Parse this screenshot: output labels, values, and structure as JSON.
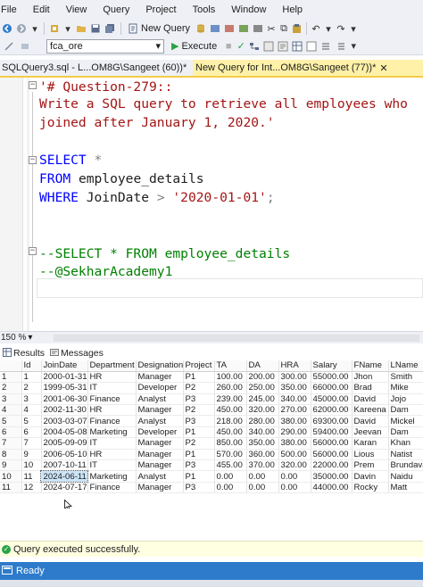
{
  "menu": [
    "File",
    "Edit",
    "View",
    "Query",
    "Project",
    "Tools",
    "Window",
    "Help"
  ],
  "toolbar": {
    "new_query_label": "New Query",
    "database": "fca_ore",
    "execute_label": "Execute"
  },
  "tabs": [
    {
      "label": "SQLQuery3.sql - L...OM8G\\Sangeet (60))*",
      "active": false
    },
    {
      "label": "New Query for Int...OM8G\\Sangeet (77))*",
      "active": true
    }
  ],
  "editor": {
    "lines": [
      "'# Question-279::",
      "Write a SQL query to retrieve all employees who",
      "joined after January 1, 2020.'",
      "",
      "SELECT *",
      "FROM employee_details",
      "WHERE JoinDate > '2020-01-01';",
      "",
      "",
      "--SELECT * FROM employee_details",
      "--@SekharAcademy1"
    ],
    "kw_select": "SELECT",
    "star": " *",
    "kw_from": "FROM",
    "table": " employee_details",
    "kw_where": "WHERE",
    "col": " JoinDate ",
    "gt": ">",
    "date_str": " '2020-01-01'",
    "semi": ";"
  },
  "zoom": "150 %",
  "results_tabs": [
    "Results",
    "Messages"
  ],
  "grid": {
    "columns": [
      "",
      "Id",
      "JoinDate",
      "Department",
      "Designation",
      "Project",
      "TA",
      "DA",
      "HRA",
      "Salary",
      "FName",
      "LName"
    ],
    "rows": [
      [
        "1",
        "1",
        "2000-01-31",
        "HR",
        "Manager",
        "P1",
        "100.00",
        "200.00",
        "300.00",
        "55000.00",
        "Jhon",
        "Smith"
      ],
      [
        "2",
        "2",
        "1999-05-31",
        "IT",
        "Developer",
        "P2",
        "260.00",
        "250.00",
        "350.00",
        "66000.00",
        "Brad",
        "Mike"
      ],
      [
        "3",
        "3",
        "2001-06-30",
        "Finance",
        "Analyst",
        "P3",
        "239.00",
        "245.00",
        "340.00",
        "45000.00",
        "David",
        "Jojo"
      ],
      [
        "4",
        "4",
        "2002-11-30",
        "HR",
        "Manager",
        "P2",
        "450.00",
        "320.00",
        "270.00",
        "62000.00",
        "Kareena",
        "Dam"
      ],
      [
        "5",
        "5",
        "2003-03-07",
        "Finance",
        "Analyst",
        "P3",
        "218.00",
        "280.00",
        "380.00",
        "69300.00",
        "David",
        "Mickel"
      ],
      [
        "6",
        "6",
        "2004-05-08",
        "Marketing",
        "Developer",
        "P1",
        "450.00",
        "340.00",
        "290.00",
        "59400.00",
        "Jeevan",
        "Dam"
      ],
      [
        "7",
        "7",
        "2005-09-09",
        "IT",
        "Manager",
        "P2",
        "850.00",
        "350.00",
        "380.00",
        "56000.00",
        "Karan",
        "Khan"
      ],
      [
        "8",
        "9",
        "2006-05-10",
        "HR",
        "Manager",
        "P1",
        "570.00",
        "360.00",
        "500.00",
        "56000.00",
        "Lious",
        "Natist"
      ],
      [
        "9",
        "10",
        "2007-10-11",
        "IT",
        "Manager",
        "P3",
        "455.00",
        "370.00",
        "320.00",
        "22000.00",
        "Prem",
        "Brundava"
      ],
      [
        "10",
        "11",
        "2024-06-11",
        "Marketing",
        "Analyst",
        "P1",
        "0.00",
        "0.00",
        "0.00",
        "35000.00",
        "Davin",
        "Naidu"
      ],
      [
        "11",
        "12",
        "2024-07-17",
        "Finance",
        "Manager",
        "P3",
        "0.00",
        "0.00",
        "0.00",
        "44000.00",
        "Rocky",
        "Matt"
      ]
    ]
  },
  "query_status": "Query executed successfully.",
  "status_bar": "Ready",
  "colors": {
    "status_blue": "#2e7bcb",
    "active_tab": "#fff1a8",
    "keyword": "#0000ff",
    "string": "#a31515",
    "comment": "#008000"
  }
}
